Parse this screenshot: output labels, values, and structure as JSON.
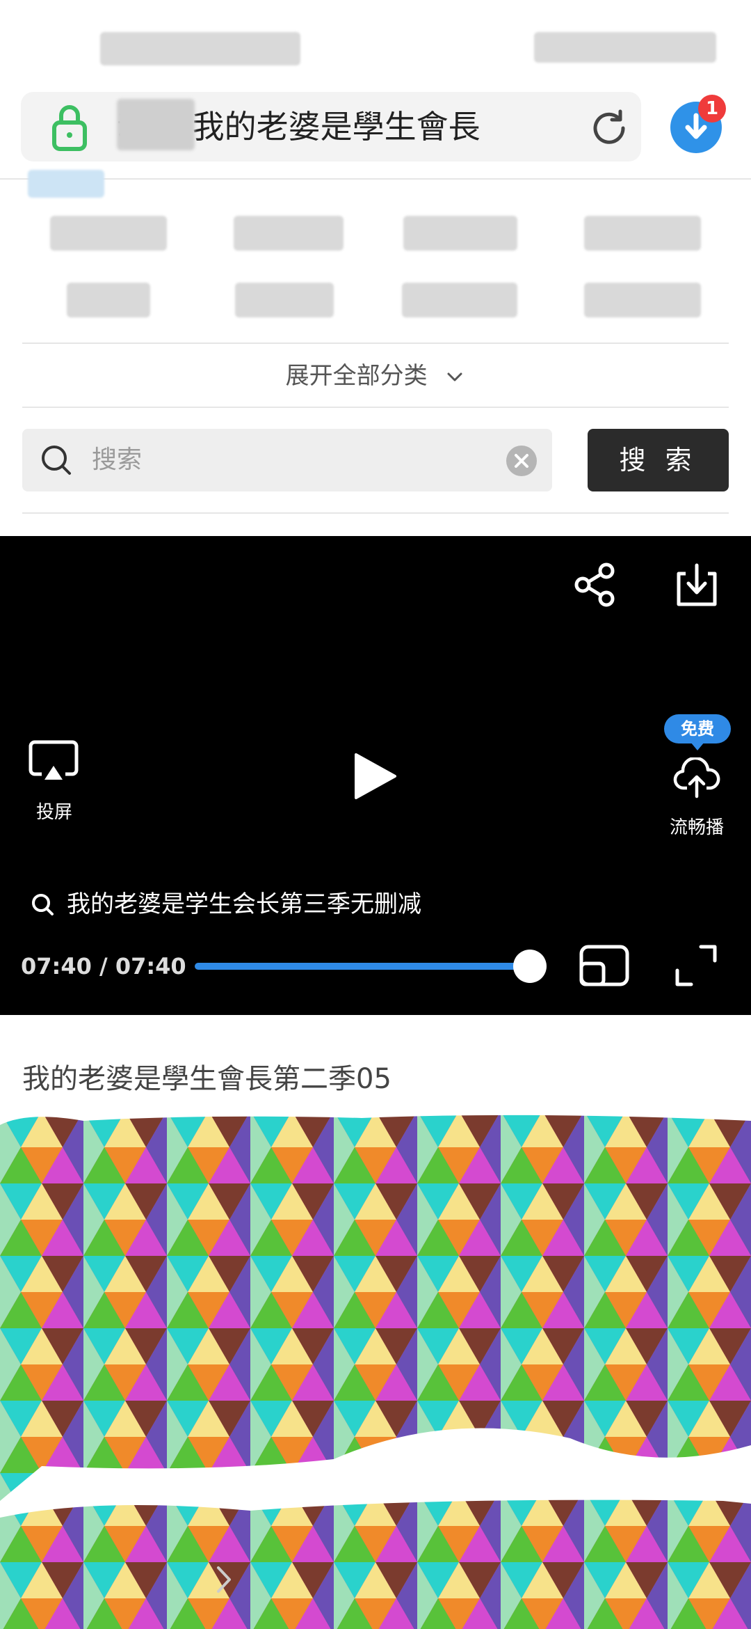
{
  "browser": {
    "url_text": "动漫-我的老婆是學生會長",
    "download_badge": "1"
  },
  "categories": {
    "expand_label": "展开全部分类"
  },
  "search": {
    "placeholder": "搜索",
    "button_label": "搜 索"
  },
  "player": {
    "cast_label": "投屏",
    "smooth_label": "流畅播",
    "free_badge": "免费",
    "suggestion": "我的老婆是学生会长第三季无删减",
    "time": "07:40 / 07:40",
    "progress": 1.0
  },
  "video": {
    "title": "我的老婆是學生會長第二季05"
  },
  "colors": {
    "accent": "#2f8ae6",
    "badge_red": "#ef3b3b",
    "lock_green": "#3dbf62"
  }
}
